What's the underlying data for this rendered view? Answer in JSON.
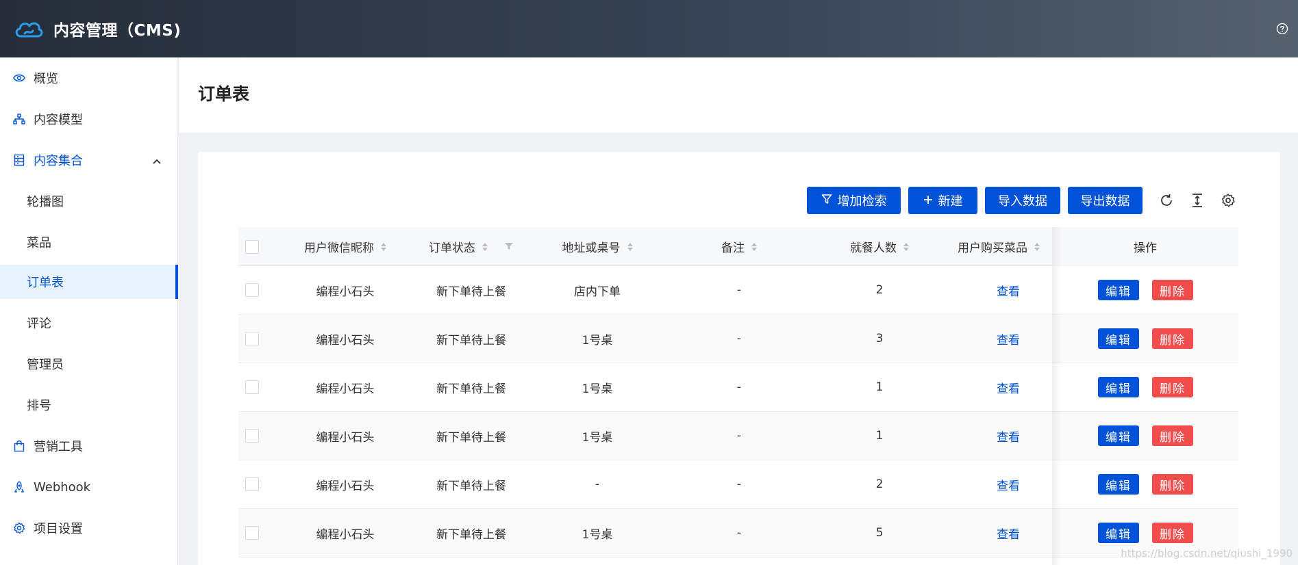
{
  "header": {
    "title": "内容管理（CMS)"
  },
  "sidebar": {
    "items": [
      {
        "label": "概览",
        "icon": "eye-icon"
      },
      {
        "label": "内容模型",
        "icon": "sitemap-icon"
      },
      {
        "label": "内容集合",
        "icon": "database-icon",
        "expanded": true
      },
      {
        "label": "轮播图"
      },
      {
        "label": "菜品"
      },
      {
        "label": "订单表",
        "active": true
      },
      {
        "label": "评论"
      },
      {
        "label": "管理员"
      },
      {
        "label": "排号"
      },
      {
        "label": "营销工具",
        "icon": "shopping-bag-icon"
      },
      {
        "label": "Webhook",
        "icon": "webhook-icon"
      },
      {
        "label": "项目设置",
        "icon": "gear-icon"
      }
    ]
  },
  "page": {
    "title": "订单表"
  },
  "toolbar": {
    "filter_label": "增加检索",
    "new_label": "新建",
    "import_label": "导入数据",
    "export_label": "导出数据"
  },
  "table": {
    "columns": [
      "用户微信昵称",
      "订单状态",
      "地址或桌号",
      "备注",
      "就餐人数",
      "用户购买菜品",
      "操作"
    ],
    "rows": [
      {
        "nickname": "编程小石头",
        "status": "新下单待上餐",
        "address": "店内下单",
        "note": "-",
        "people": "2",
        "dishes": "查看"
      },
      {
        "nickname": "编程小石头",
        "status": "新下单待上餐",
        "address": "1号桌",
        "note": "-",
        "people": "3",
        "dishes": "查看"
      },
      {
        "nickname": "编程小石头",
        "status": "新下单待上餐",
        "address": "1号桌",
        "note": "-",
        "people": "1",
        "dishes": "查看"
      },
      {
        "nickname": "编程小石头",
        "status": "新下单待上餐",
        "address": "1号桌",
        "note": "-",
        "people": "1",
        "dishes": "查看"
      },
      {
        "nickname": "编程小石头",
        "status": "新下单待上餐",
        "address": "-",
        "note": "-",
        "people": "2",
        "dishes": "查看"
      },
      {
        "nickname": "编程小石头",
        "status": "新下单待上餐",
        "address": "1号桌",
        "note": "-",
        "people": "5",
        "dishes": "查看"
      }
    ],
    "edit_label": "编辑",
    "delete_label": "删除"
  },
  "watermark": "https://blog.csdn.net/qiushi_1990",
  "colors": {
    "primary": "#0052d9",
    "danger": "#f24d4d",
    "header_dark": "#252d3a"
  }
}
